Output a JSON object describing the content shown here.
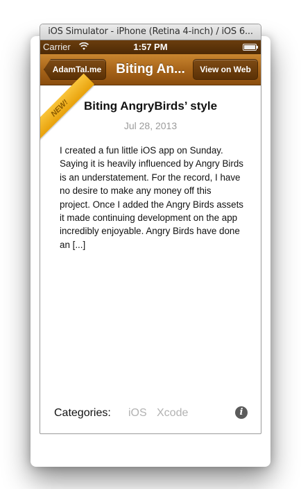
{
  "window": {
    "title": "iOS Simulator - iPhone (Retina 4-inch) / iOS 6..."
  },
  "status_bar": {
    "carrier": "Carrier",
    "time": "1:57 PM"
  },
  "nav": {
    "back_label": "AdamTal.me",
    "title": "Biting An...",
    "web_button_label": "View on Web",
    "color": "#a8651a"
  },
  "post": {
    "ribbon": "NEW!",
    "title": "Biting AngryBirds’ style",
    "date": "Jul 28, 2013",
    "excerpt": "I created a fun little iOS app on Sunday. Saying it is heavily influenced by Angry Birds is an understatement. For the record, I have no desire to make any money off this project. Once I added the Angry Birds assets it made continuing development on the app incredibly enjoyable. Angry Birds have done an [...]"
  },
  "footer": {
    "categories_label": "Categories:",
    "categories": [
      "iOS",
      "Xcode"
    ],
    "info_icon": "info-icon"
  }
}
